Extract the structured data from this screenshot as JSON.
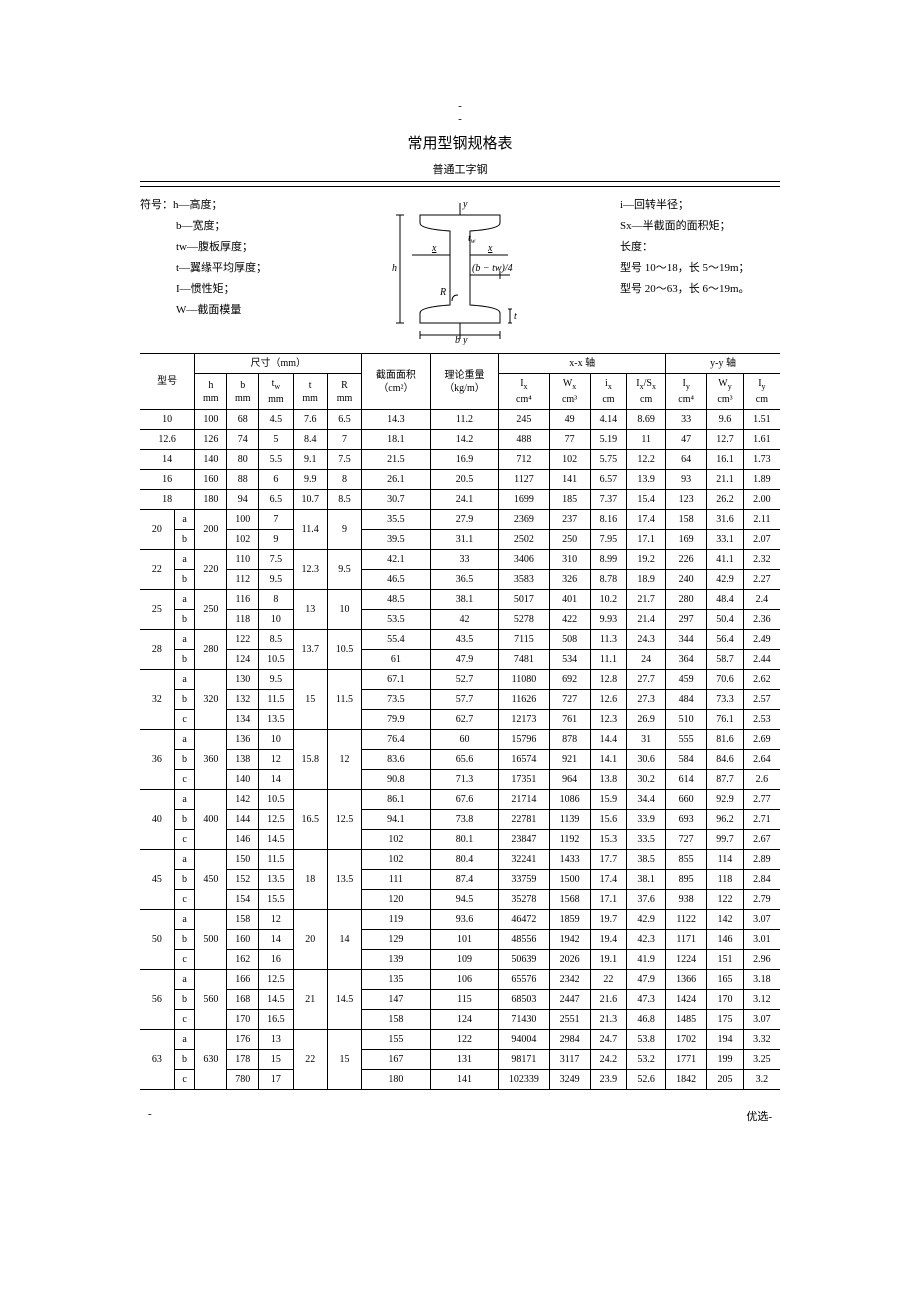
{
  "header": {
    "dash1": "-",
    "dash2": "-",
    "title": "常用型钢规格表",
    "subtitle": "普通工字钢"
  },
  "legend_left": {
    "prefix": "符号：",
    "items": [
      "h—高度；",
      "b—宽度；",
      "tw—腹板厚度；",
      "t—翼缘平均厚度；",
      "I—惯性矩；",
      "W—截面模量"
    ]
  },
  "legend_right": {
    "items": [
      "i—回转半径；",
      "Sx—半截面的面积矩；",
      "长度：",
      "型号 10～18，长 5～19m；",
      "型号 20～63，长 6～19m。"
    ]
  },
  "diagram_labels": {
    "y": "y",
    "x": "x",
    "tw": "tw",
    "h": "h",
    "b": "b",
    "R": "R",
    "btw4": "(b − tw)/4"
  },
  "table": {
    "cap_dim": "尺寸（mm）",
    "cap_type": "型号",
    "cap_area": "截面面积",
    "cap_area_unit": "（cm²）",
    "cap_weight": "理论重量",
    "cap_weight_unit": "（kg/m）",
    "cap_xx": "x-x 轴",
    "cap_yy": "y-y 轴",
    "cols": {
      "h": "h",
      "b": "b",
      "tw": "tw",
      "t": "t",
      "R": "R",
      "Ix": "Ix",
      "Wx": "Wx",
      "ix": "ix",
      "IxSx": "Ix/Sx",
      "Iy": "Iy",
      "Wy": "Wy",
      "iy": "Iy",
      "mm": "mm",
      "cm4": "cm⁴",
      "cm3": "cm³",
      "cm": "cm"
    }
  },
  "rows_simple": [
    {
      "type": "10",
      "h": "100",
      "b": "68",
      "tw": "4.5",
      "t": "7.6",
      "R": "6.5",
      "area": "14.3",
      "wt": "11.2",
      "Ix": "245",
      "Wx": "49",
      "ix": "4.14",
      "IxSx": "8.69",
      "Iy": "33",
      "Wy": "9.6",
      "iy": "1.51"
    },
    {
      "type": "12.6",
      "h": "126",
      "b": "74",
      "tw": "5",
      "t": "8.4",
      "R": "7",
      "area": "18.1",
      "wt": "14.2",
      "Ix": "488",
      "Wx": "77",
      "ix": "5.19",
      "IxSx": "11",
      "Iy": "47",
      "Wy": "12.7",
      "iy": "1.61"
    },
    {
      "type": "14",
      "h": "140",
      "b": "80",
      "tw": "5.5",
      "t": "9.1",
      "R": "7.5",
      "area": "21.5",
      "wt": "16.9",
      "Ix": "712",
      "Wx": "102",
      "ix": "5.75",
      "IxSx": "12.2",
      "Iy": "64",
      "Wy": "16.1",
      "iy": "1.73"
    },
    {
      "type": "16",
      "h": "160",
      "b": "88",
      "tw": "6",
      "t": "9.9",
      "R": "8",
      "area": "26.1",
      "wt": "20.5",
      "Ix": "1127",
      "Wx": "141",
      "ix": "6.57",
      "IxSx": "13.9",
      "Iy": "93",
      "Wy": "21.1",
      "iy": "1.89"
    },
    {
      "type": "18",
      "h": "180",
      "b": "94",
      "tw": "6.5",
      "t": "10.7",
      "R": "8.5",
      "area": "30.7",
      "wt": "24.1",
      "Ix": "1699",
      "Wx": "185",
      "ix": "7.37",
      "IxSx": "15.4",
      "Iy": "123",
      "Wy": "26.2",
      "iy": "2.00"
    }
  ],
  "rows_ab": [
    {
      "type": "20",
      "h": "200",
      "t": "11.4",
      "R": "9",
      "subs": [
        {
          "k": "a",
          "b": "100",
          "tw": "7",
          "area": "35.5",
          "wt": "27.9",
          "Ix": "2369",
          "Wx": "237",
          "ix": "8.16",
          "IxSx": "17.4",
          "Iy": "158",
          "Wy": "31.6",
          "iy": "2.11"
        },
        {
          "k": "b",
          "b": "102",
          "tw": "9",
          "area": "39.5",
          "wt": "31.1",
          "Ix": "2502",
          "Wx": "250",
          "ix": "7.95",
          "IxSx": "17.1",
          "Iy": "169",
          "Wy": "33.1",
          "iy": "2.07"
        }
      ]
    },
    {
      "type": "22",
      "h": "220",
      "t": "12.3",
      "R": "9.5",
      "subs": [
        {
          "k": "a",
          "b": "110",
          "tw": "7.5",
          "area": "42.1",
          "wt": "33",
          "Ix": "3406",
          "Wx": "310",
          "ix": "8.99",
          "IxSx": "19.2",
          "Iy": "226",
          "Wy": "41.1",
          "iy": "2.32"
        },
        {
          "k": "b",
          "b": "112",
          "tw": "9.5",
          "area": "46.5",
          "wt": "36.5",
          "Ix": "3583",
          "Wx": "326",
          "ix": "8.78",
          "IxSx": "18.9",
          "Iy": "240",
          "Wy": "42.9",
          "iy": "2.27"
        }
      ]
    },
    {
      "type": "25",
      "h": "250",
      "t": "13",
      "R": "10",
      "subs": [
        {
          "k": "a",
          "b": "116",
          "tw": "8",
          "area": "48.5",
          "wt": "38.1",
          "Ix": "5017",
          "Wx": "401",
          "ix": "10.2",
          "IxSx": "21.7",
          "Iy": "280",
          "Wy": "48.4",
          "iy": "2.4"
        },
        {
          "k": "b",
          "b": "118",
          "tw": "10",
          "area": "53.5",
          "wt": "42",
          "Ix": "5278",
          "Wx": "422",
          "ix": "9.93",
          "IxSx": "21.4",
          "Iy": "297",
          "Wy": "50.4",
          "iy": "2.36"
        }
      ]
    },
    {
      "type": "28",
      "h": "280",
      "t": "13.7",
      "R": "10.5",
      "subs": [
        {
          "k": "a",
          "b": "122",
          "tw": "8.5",
          "area": "55.4",
          "wt": "43.5",
          "Ix": "7115",
          "Wx": "508",
          "ix": "11.3",
          "IxSx": "24.3",
          "Iy": "344",
          "Wy": "56.4",
          "iy": "2.49"
        },
        {
          "k": "b",
          "b": "124",
          "tw": "10.5",
          "area": "61",
          "wt": "47.9",
          "Ix": "7481",
          "Wx": "534",
          "ix": "11.1",
          "IxSx": "24",
          "Iy": "364",
          "Wy": "58.7",
          "iy": "2.44"
        }
      ]
    }
  ],
  "rows_abc": [
    {
      "type": "32",
      "h": "320",
      "t": "15",
      "R": "11.5",
      "subs": [
        {
          "k": "a",
          "b": "130",
          "tw": "9.5",
          "area": "67.1",
          "wt": "52.7",
          "Ix": "11080",
          "Wx": "692",
          "ix": "12.8",
          "IxSx": "27.7",
          "Iy": "459",
          "Wy": "70.6",
          "iy": "2.62"
        },
        {
          "k": "b",
          "b": "132",
          "tw": "11.5",
          "area": "73.5",
          "wt": "57.7",
          "Ix": "11626",
          "Wx": "727",
          "ix": "12.6",
          "IxSx": "27.3",
          "Iy": "484",
          "Wy": "73.3",
          "iy": "2.57"
        },
        {
          "k": "c",
          "b": "134",
          "tw": "13.5",
          "area": "79.9",
          "wt": "62.7",
          "Ix": "12173",
          "Wx": "761",
          "ix": "12.3",
          "IxSx": "26.9",
          "Iy": "510",
          "Wy": "76.1",
          "iy": "2.53"
        }
      ]
    },
    {
      "type": "36",
      "h": "360",
      "t": "15.8",
      "R": "12",
      "subs": [
        {
          "k": "a",
          "b": "136",
          "tw": "10",
          "area": "76.4",
          "wt": "60",
          "Ix": "15796",
          "Wx": "878",
          "ix": "14.4",
          "IxSx": "31",
          "Iy": "555",
          "Wy": "81.6",
          "iy": "2.69"
        },
        {
          "k": "b",
          "b": "138",
          "tw": "12",
          "area": "83.6",
          "wt": "65.6",
          "Ix": "16574",
          "Wx": "921",
          "ix": "14.1",
          "IxSx": "30.6",
          "Iy": "584",
          "Wy": "84.6",
          "iy": "2.64"
        },
        {
          "k": "c",
          "b": "140",
          "tw": "14",
          "area": "90.8",
          "wt": "71.3",
          "Ix": "17351",
          "Wx": "964",
          "ix": "13.8",
          "IxSx": "30.2",
          "Iy": "614",
          "Wy": "87.7",
          "iy": "2.6"
        }
      ]
    },
    {
      "type": "40",
      "h": "400",
      "t": "16.5",
      "R": "12.5",
      "subs": [
        {
          "k": "a",
          "b": "142",
          "tw": "10.5",
          "area": "86.1",
          "wt": "67.6",
          "Ix": "21714",
          "Wx": "1086",
          "ix": "15.9",
          "IxSx": "34.4",
          "Iy": "660",
          "Wy": "92.9",
          "iy": "2.77"
        },
        {
          "k": "b",
          "b": "144",
          "tw": "12.5",
          "area": "94.1",
          "wt": "73.8",
          "Ix": "22781",
          "Wx": "1139",
          "ix": "15.6",
          "IxSx": "33.9",
          "Iy": "693",
          "Wy": "96.2",
          "iy": "2.71"
        },
        {
          "k": "c",
          "b": "146",
          "tw": "14.5",
          "area": "102",
          "wt": "80.1",
          "Ix": "23847",
          "Wx": "1192",
          "ix": "15.3",
          "IxSx": "33.5",
          "Iy": "727",
          "Wy": "99.7",
          "iy": "2.67"
        }
      ]
    },
    {
      "type": "45",
      "h": "450",
      "t": "18",
      "R": "13.5",
      "subs": [
        {
          "k": "a",
          "b": "150",
          "tw": "11.5",
          "area": "102",
          "wt": "80.4",
          "Ix": "32241",
          "Wx": "1433",
          "ix": "17.7",
          "IxSx": "38.5",
          "Iy": "855",
          "Wy": "114",
          "iy": "2.89"
        },
        {
          "k": "b",
          "b": "152",
          "tw": "13.5",
          "area": "111",
          "wt": "87.4",
          "Ix": "33759",
          "Wx": "1500",
          "ix": "17.4",
          "IxSx": "38.1",
          "Iy": "895",
          "Wy": "118",
          "iy": "2.84"
        },
        {
          "k": "c",
          "b": "154",
          "tw": "15.5",
          "area": "120",
          "wt": "94.5",
          "Ix": "35278",
          "Wx": "1568",
          "ix": "17.1",
          "IxSx": "37.6",
          "Iy": "938",
          "Wy": "122",
          "iy": "2.79"
        }
      ]
    },
    {
      "type": "50",
      "h": "500",
      "t": "20",
      "R": "14",
      "subs": [
        {
          "k": "a",
          "b": "158",
          "tw": "12",
          "area": "119",
          "wt": "93.6",
          "Ix": "46472",
          "Wx": "1859",
          "ix": "19.7",
          "IxSx": "42.9",
          "Iy": "1122",
          "Wy": "142",
          "iy": "3.07"
        },
        {
          "k": "b",
          "b": "160",
          "tw": "14",
          "area": "129",
          "wt": "101",
          "Ix": "48556",
          "Wx": "1942",
          "ix": "19.4",
          "IxSx": "42.3",
          "Iy": "1171",
          "Wy": "146",
          "iy": "3.01"
        },
        {
          "k": "c",
          "b": "162",
          "tw": "16",
          "area": "139",
          "wt": "109",
          "Ix": "50639",
          "Wx": "2026",
          "ix": "19.1",
          "IxSx": "41.9",
          "Iy": "1224",
          "Wy": "151",
          "iy": "2.96"
        }
      ]
    },
    {
      "type": "56",
      "h": "560",
      "t": "21",
      "R": "14.5",
      "subs": [
        {
          "k": "a",
          "b": "166",
          "tw": "12.5",
          "area": "135",
          "wt": "106",
          "Ix": "65576",
          "Wx": "2342",
          "ix": "22",
          "IxSx": "47.9",
          "Iy": "1366",
          "Wy": "165",
          "iy": "3.18"
        },
        {
          "k": "b",
          "b": "168",
          "tw": "14.5",
          "area": "147",
          "wt": "115",
          "Ix": "68503",
          "Wx": "2447",
          "ix": "21.6",
          "IxSx": "47.3",
          "Iy": "1424",
          "Wy": "170",
          "iy": "3.12"
        },
        {
          "k": "c",
          "b": "170",
          "tw": "16.5",
          "area": "158",
          "wt": "124",
          "Ix": "71430",
          "Wx": "2551",
          "ix": "21.3",
          "IxSx": "46.8",
          "Iy": "1485",
          "Wy": "175",
          "iy": "3.07"
        }
      ]
    },
    {
      "type": "63",
      "h": "630",
      "t": "22",
      "R": "15",
      "subs": [
        {
          "k": "a",
          "b": "176",
          "tw": "13",
          "area": "155",
          "wt": "122",
          "Ix": "94004",
          "Wx": "2984",
          "ix": "24.7",
          "IxSx": "53.8",
          "Iy": "1702",
          "Wy": "194",
          "iy": "3.32"
        },
        {
          "k": "b",
          "b": "178",
          "tw": "15",
          "area": "167",
          "wt": "131",
          "Ix": "98171",
          "Wx": "3117",
          "ix": "24.2",
          "IxSx": "53.2",
          "Iy": "1771",
          "Wy": "199",
          "iy": "3.25"
        },
        {
          "k": "c",
          "b": "780",
          "tw": "17",
          "area": "180",
          "wt": "141",
          "Ix": "102339",
          "Wx": "3249",
          "ix": "23.9",
          "IxSx": "52.6",
          "Iy": "1842",
          "Wy": "205",
          "iy": "3.2"
        }
      ]
    }
  ],
  "footer": {
    "left": "-",
    "right": "优选-"
  }
}
